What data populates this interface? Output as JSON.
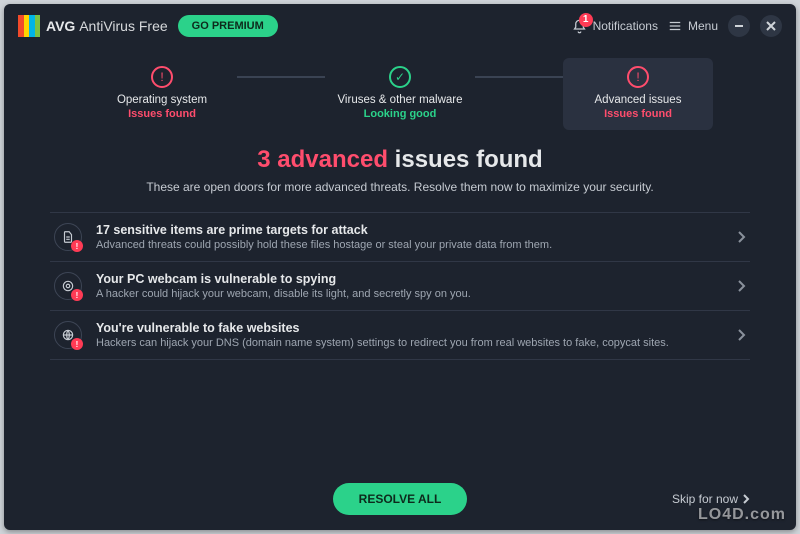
{
  "brand": {
    "name": "AVG",
    "product": "AntiVirus Free"
  },
  "header": {
    "go_premium": "GO PREMIUM",
    "notifications_label": "Notifications",
    "notifications_count": "1",
    "menu_label": "Menu"
  },
  "steps": [
    {
      "title": "Operating system",
      "status": "Issues found",
      "tone": "pink",
      "glyph": "!"
    },
    {
      "title": "Viruses & other malware",
      "status": "Looking good",
      "tone": "green",
      "glyph": "✓"
    },
    {
      "title": "Advanced issues",
      "status": "Issues found",
      "tone": "pink",
      "glyph": "!"
    }
  ],
  "headline": {
    "count": "3 advanced",
    "tail": " issues found"
  },
  "subhead": "These are open doors for more advanced threats. Resolve them now to maximize your security.",
  "issues": [
    {
      "icon": "file",
      "title": "17 sensitive items are prime targets for attack",
      "desc": "Advanced threats could possibly hold these files hostage or steal your private data from them."
    },
    {
      "icon": "camera",
      "title": "Your PC webcam is vulnerable to spying",
      "desc": "A hacker could hijack your webcam, disable its light, and secretly spy on you."
    },
    {
      "icon": "globe",
      "title": "You're vulnerable to fake websites",
      "desc": "Hackers can hijack your DNS (domain name system) settings to redirect you from real websites to fake, copycat sites."
    }
  ],
  "footer": {
    "resolve": "RESOLVE ALL",
    "skip": "Skip for now"
  },
  "watermark": "LO4D.com"
}
